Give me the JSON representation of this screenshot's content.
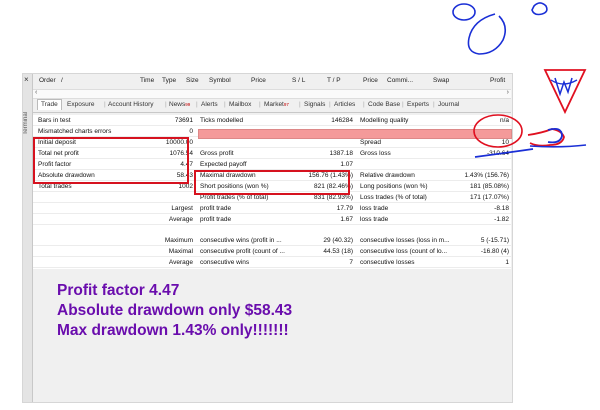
{
  "window": {
    "side_label": "Terminal",
    "close_glyph": "×",
    "columns": [
      "Order",
      "/",
      "Time",
      "Type",
      "Size",
      "Symbol",
      "Price",
      "S / L",
      "T / P",
      "Price",
      "Commi...",
      "Swap",
      "Profit"
    ]
  },
  "tabs": [
    {
      "label": "Trade",
      "active": true
    },
    {
      "label": "Exposure"
    },
    {
      "label": "Account History"
    },
    {
      "label": "News",
      "badge": "99"
    },
    {
      "label": "Alerts"
    },
    {
      "label": "Mailbox"
    },
    {
      "label": "Market",
      "badge": "97"
    },
    {
      "label": "Signals"
    },
    {
      "label": "Articles"
    },
    {
      "label": "Code Base"
    },
    {
      "label": "Experts"
    },
    {
      "label": "Journal"
    }
  ],
  "report": {
    "bars_in_test": {
      "label": "Bars in test",
      "value": "73691"
    },
    "ticks_modelled": {
      "label": "Ticks modelled",
      "value": "146284"
    },
    "modelling_quality": {
      "label": "Modelling quality",
      "value": "n/a"
    },
    "mismatched": {
      "label": "Mismatched charts errors",
      "value": "0"
    },
    "initial_deposit": {
      "label": "Initial deposit",
      "value": "10000.00"
    },
    "spread": {
      "label": "Spread",
      "value": "10"
    },
    "total_net_profit": {
      "label": "Total net profit",
      "value": "1076.54"
    },
    "gross_profit": {
      "label": "Gross profit",
      "value": "1387.18"
    },
    "gross_loss": {
      "label": "Gross loss",
      "value": "-310.64"
    },
    "profit_factor": {
      "label": "Profit factor",
      "value": "4.47"
    },
    "expected_payoff": {
      "label": "Expected payoff",
      "value": "1.07"
    },
    "absolute_drawdown": {
      "label": "Absolute drawdown",
      "value": "58.43"
    },
    "maximal_drawdown": {
      "label": "Maximal drawdown",
      "value": "156.76 (1.43%)"
    },
    "relative_drawdown": {
      "label": "Relative drawdown",
      "value": "1.43% (156.76)"
    },
    "total_trades": {
      "label": "Total trades",
      "value": "1002"
    },
    "short_positions": {
      "label": "Short positions (won %)",
      "value": "821 (82.46%)"
    },
    "long_positions": {
      "label": "Long positions (won %)",
      "value": "181 (85.08%)"
    },
    "profit_trades": {
      "label": "Profit trades (% of total)",
      "value": "831 (82.93%)"
    },
    "loss_trades": {
      "label": "Loss trades (% of total)",
      "value": "171 (17.07%)"
    },
    "largest": {
      "label": "Largest",
      "profit_label": "profit trade",
      "profit_value": "17.79",
      "loss_label": "loss trade",
      "loss_value": "-8.18"
    },
    "average": {
      "label": "Average",
      "profit_label": "profit trade",
      "profit_value": "1.67",
      "loss_label": "loss trade",
      "loss_value": "-1.82"
    },
    "maximum": {
      "label": "Maximum",
      "profit_label": "consecutive wins (profit in ...",
      "profit_value": "29 (40.32)",
      "loss_label": "consecutive losses (loss in m...",
      "loss_value": "5 (-15.71)"
    },
    "maximal": {
      "label": "Maximal",
      "profit_label": "consecutive profit (count of ...",
      "profit_value": "44.53 (18)",
      "loss_label": "consecutive loss (count of lo...",
      "loss_value": "-16.80 (4)"
    },
    "average_consec": {
      "label": "Average",
      "profit_label": "consecutive wins",
      "profit_value": "7",
      "loss_label": "consecutive losses",
      "loss_value": "1"
    }
  },
  "annotations": {
    "line1": "Profit factor 4.47",
    "line2": "Absolute drawdown only $58.43",
    "line3": "Max drawdown 1.43% only!!!!!!!"
  },
  "colors": {
    "highlight": "#d6121f",
    "annotation_text": "#6a0dad",
    "pen_blue": "#1a2fd6",
    "quality_bar": "#f49a9a"
  }
}
